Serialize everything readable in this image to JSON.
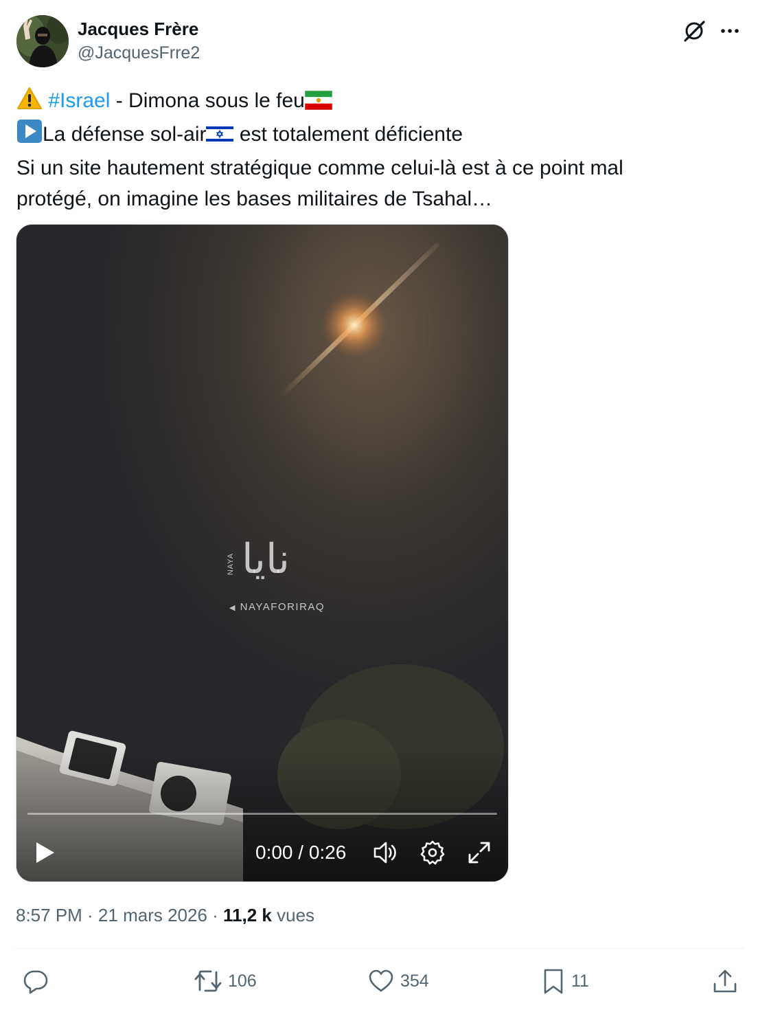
{
  "author": {
    "display_name": "Jacques Frère",
    "handle": "@JacquesFrre2",
    "avatar_icon": "avatar-masked-person"
  },
  "header_icons": [
    "grok-icon",
    "more-icon"
  ],
  "tweet": {
    "line1_warning_emoji": "⚠️",
    "line1_hashtag": "#Israel",
    "line1_text": " - Dimona sous le feu",
    "line1_flag": "iran-flag",
    "line2_emoji": "▶️",
    "line2_text_before": "La défense sol-air",
    "line2_flag": "israel-flag",
    "line2_text_after": " est totalement déficiente",
    "line3": "Si un site hautement stratégique comme celui-là est à ce point mal",
    "line4": "protégé, on imagine les bases militaires de Tsahal…"
  },
  "video": {
    "watermark_arabic": "نايا",
    "watermark_small": "NAYA",
    "watermark_handle": "NAYAFORIRAQ",
    "time": "0:00 / 0:26",
    "progress_fraction": 0.0
  },
  "meta": {
    "time": "8:57 PM · 21 mars 2026 · ",
    "views_count": "11,2 k",
    "views_label": " vues"
  },
  "actions": {
    "reply_count": "",
    "retweet_count": "106",
    "like_count": "354",
    "bookmark_count": "11"
  },
  "colors": {
    "link": "#1d9bf0",
    "secondary_text": "#536471",
    "primary_text": "#0f1419"
  }
}
